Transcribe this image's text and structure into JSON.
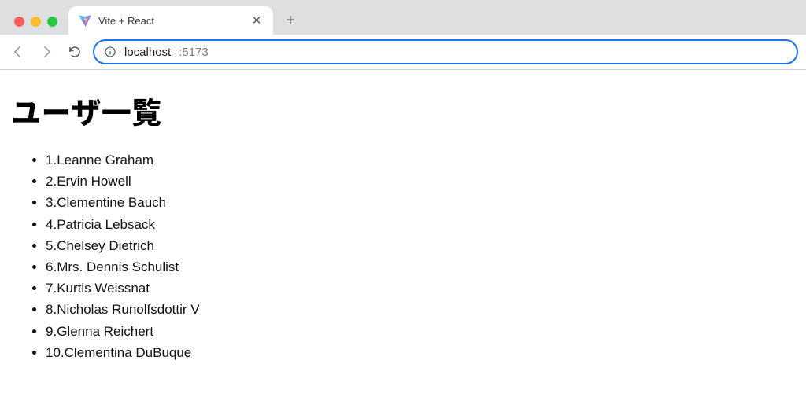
{
  "browser": {
    "tab": {
      "title": "Vite + React"
    },
    "address": {
      "host": "localhost",
      "port": ":5173"
    }
  },
  "page": {
    "heading": "ユーザ一覧",
    "users": [
      {
        "id": 1,
        "name": "Leanne Graham"
      },
      {
        "id": 2,
        "name": "Ervin Howell"
      },
      {
        "id": 3,
        "name": "Clementine Bauch"
      },
      {
        "id": 4,
        "name": "Patricia Lebsack"
      },
      {
        "id": 5,
        "name": "Chelsey Dietrich"
      },
      {
        "id": 6,
        "name": "Mrs. Dennis Schulist"
      },
      {
        "id": 7,
        "name": "Kurtis Weissnat"
      },
      {
        "id": 8,
        "name": "Nicholas Runolfsdottir V"
      },
      {
        "id": 9,
        "name": "Glenna Reichert"
      },
      {
        "id": 10,
        "name": "Clementina DuBuque"
      }
    ]
  }
}
